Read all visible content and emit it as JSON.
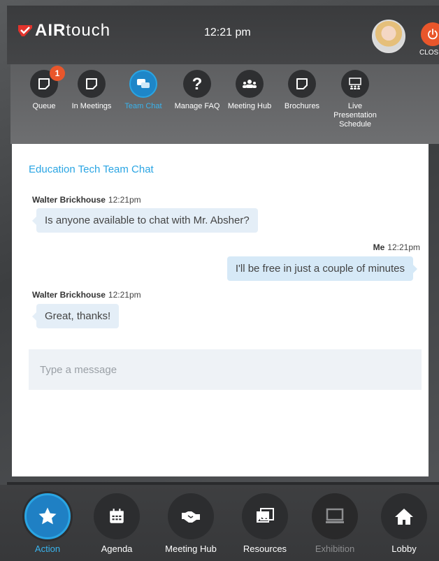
{
  "header": {
    "logo_bold": "AIR",
    "logo_light": "touch",
    "time": "12:21 pm",
    "close_label": "CLOSE"
  },
  "actions": [
    {
      "label": "Queue",
      "icon": "note-icon",
      "badge": "1"
    },
    {
      "label": "In Meetings",
      "icon": "note-icon"
    },
    {
      "label": "Team Chat",
      "icon": "chat-icon",
      "active": true
    },
    {
      "label": "Manage FAQ",
      "icon": "question-icon"
    },
    {
      "label": "Meeting Hub",
      "icon": "group-icon"
    },
    {
      "label": "Brochures",
      "icon": "note-icon"
    },
    {
      "label": "Live Presentation Schedule",
      "icon": "presentation-icon"
    }
  ],
  "chat": {
    "title": "Education Tech Team Chat",
    "messages": [
      {
        "sender": "Walter Brickhouse",
        "time": "12:21pm",
        "text": "Is anyone available to chat with Mr. Absher?"
      },
      {
        "sender": "Me",
        "time": "12:21pm",
        "text": "I'll be free in just a couple of minutes"
      },
      {
        "sender": "Walter Brickhouse",
        "time": "12:21pm",
        "text": "Great, thanks!"
      }
    ],
    "input_placeholder": "Type a message"
  },
  "bottom_nav": [
    {
      "label": "Action",
      "icon": "star-icon",
      "active": true
    },
    {
      "label": "Agenda",
      "icon": "calendar-icon"
    },
    {
      "label": "Meeting Hub",
      "icon": "handshake-icon"
    },
    {
      "label": "Resources",
      "icon": "images-icon"
    },
    {
      "label": "Exhibition",
      "icon": "monitor-icon",
      "disabled": true
    },
    {
      "label": "Lobby",
      "icon": "home-icon"
    }
  ],
  "colors": {
    "accent": "#2aa5e3",
    "close": "#e9562b",
    "logo_red": "#e2332c"
  }
}
